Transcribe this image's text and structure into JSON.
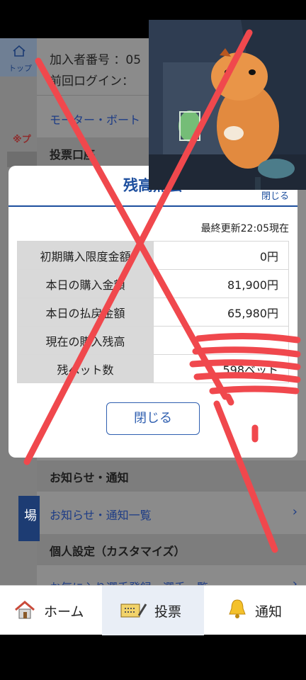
{
  "left_nav": {
    "top_label": "トップ",
    "warning_mark": "※プ",
    "side_button_label": "場"
  },
  "menu": {
    "member_number": "加入者番号 ：05",
    "last_login": "前回ログイン：",
    "motor_boat_link": "モーター・ボート",
    "voting_account_section": "投票口座",
    "notice_section": "お知らせ・通知",
    "notice_list_link": "お知らせ・通知一覧",
    "personal_section": "個人設定（カスタマイズ）",
    "favorites_link": "お気に入り選手登録・選手一覧"
  },
  "modal": {
    "title": "残高照会",
    "close_link": "閉じる",
    "updated_at": "最終更新22:05現在",
    "rows": [
      {
        "label": "初期購入限度金額",
        "value": "0円"
      },
      {
        "label": "本日の購入金額",
        "value": "81,900円"
      },
      {
        "label": "本日の払戻金額",
        "value": "65,980円"
      },
      {
        "label": "現在の購入残高",
        "value": ""
      },
      {
        "label": "残ベット数",
        "value": "598ベット"
      }
    ],
    "close_button": "閉じる"
  },
  "tabbar": {
    "tabs": [
      {
        "label": "ホーム",
        "icon": "home-icon"
      },
      {
        "label": "投票",
        "icon": "ticket-icon"
      },
      {
        "label": "通知",
        "icon": "bell-icon"
      }
    ]
  },
  "colors": {
    "brand_blue": "#1d4f9e",
    "mark_red": "#f0484d"
  }
}
